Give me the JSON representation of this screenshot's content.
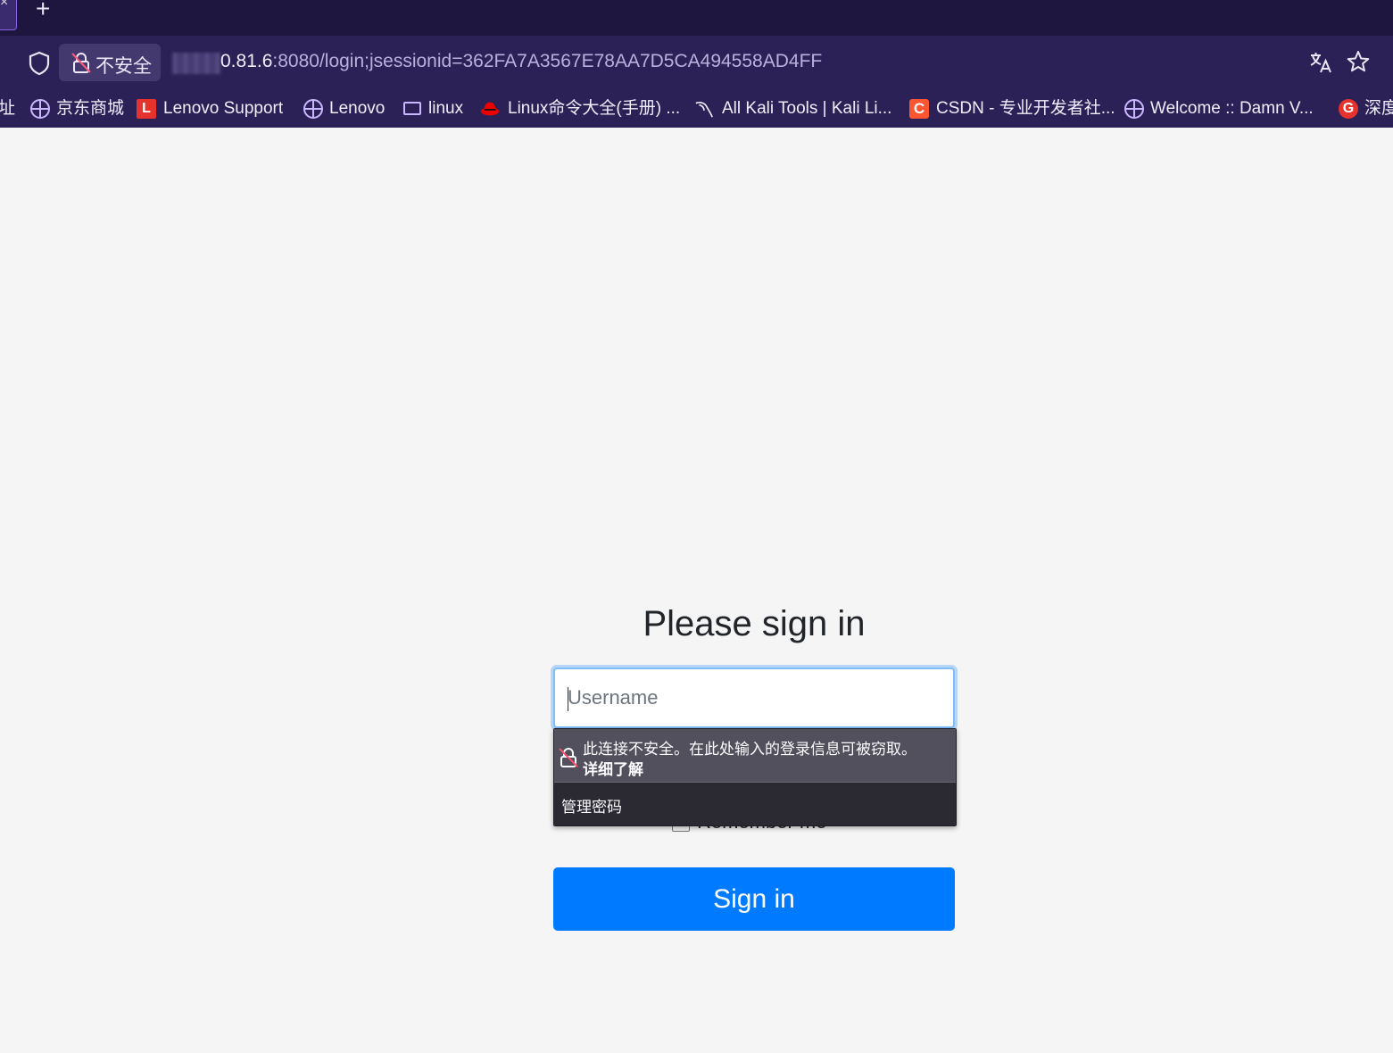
{
  "browser": {
    "new_tab_glyph": "+",
    "security_label": "不安全",
    "url_host": "0.81.6",
    "url_rest": ":8080/login;jsessionid=362FA7A3567E78AA7D5CA494558AD4FF",
    "accent_color": "#2b2156"
  },
  "bookmarks": [
    {
      "label": "址",
      "icon": "none"
    },
    {
      "label": "京东商城",
      "icon": "globe-icon"
    },
    {
      "label": "Lenovo Support",
      "icon": "lenovo-l-icon"
    },
    {
      "label": "Lenovo",
      "icon": "globe-icon"
    },
    {
      "label": "linux",
      "icon": "folder-icon"
    },
    {
      "label": "Linux命令大全(手册) ...",
      "icon": "redhat-icon"
    },
    {
      "label": "All Kali Tools | Kali Li...",
      "icon": "kali-dragon-icon"
    },
    {
      "label": "CSDN - 专业开发者社...",
      "icon": "csdn-c-icon"
    },
    {
      "label": "Welcome :: Damn V...",
      "icon": "globe-icon"
    },
    {
      "label": "深度",
      "icon": "g-badge-icon"
    }
  ],
  "bookmark_icon_glyphs": {
    "lenovo": "L",
    "csdn": "C",
    "g": "G"
  },
  "login": {
    "heading": "Please sign in",
    "username_placeholder": "Username",
    "remember_label": "Remember me",
    "signin_label": "Sign in",
    "button_color": "#007bff"
  },
  "autofill_popup": {
    "warning": "此连接不安全。在此处输入的登录信息可被窃取。",
    "learn_more": "详细了解",
    "manage_passwords": "管理密码"
  }
}
